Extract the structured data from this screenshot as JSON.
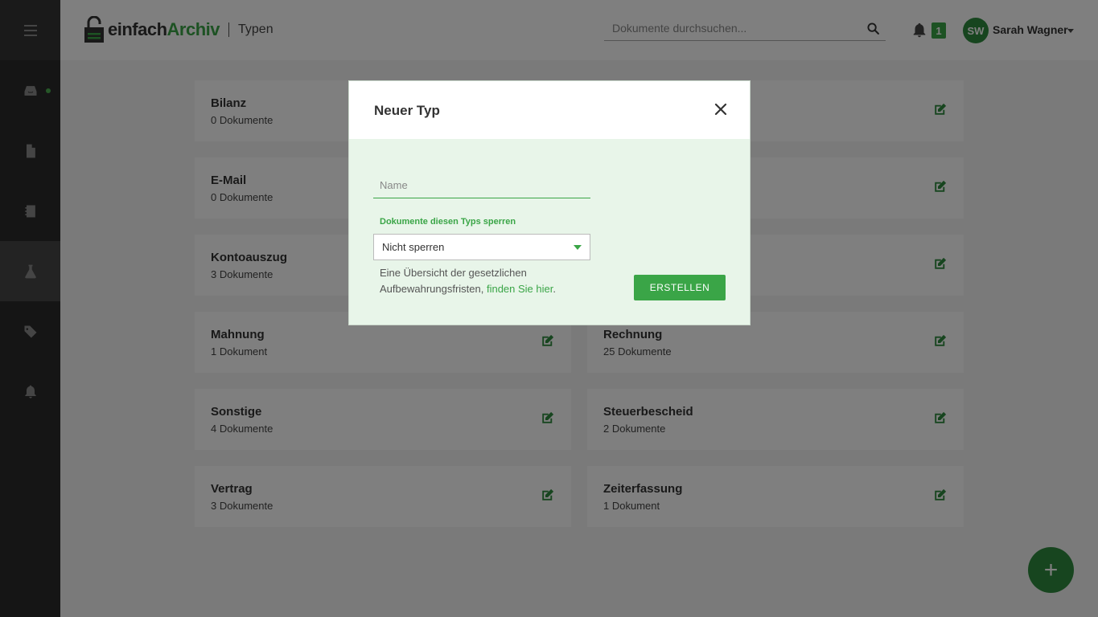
{
  "colors": {
    "brand_green": "#3aa547",
    "sidebar_bg": "#2b2b2b",
    "modal_bg": "#e8f5e9"
  },
  "sidebar": {
    "items": [
      {
        "name": "inbox-icon",
        "active": false,
        "has_dot": true
      },
      {
        "name": "document-icon",
        "active": false
      },
      {
        "name": "binder-icon",
        "active": false
      },
      {
        "name": "flask-icon",
        "active": true
      },
      {
        "name": "tag-icon",
        "active": false
      },
      {
        "name": "bell-icon",
        "active": false
      }
    ]
  },
  "header": {
    "logo_part1": "einfach",
    "logo_part2": "Archiv",
    "page_name": "Typen",
    "search_placeholder": "Dokumente durchsuchen...",
    "notification_count": "1",
    "user_initials": "SW",
    "user_name": "Sarah Wagner"
  },
  "cards": [
    {
      "title": "Bilanz",
      "count": "0 Dokumente"
    },
    {
      "title": "",
      "count": ""
    },
    {
      "title": "E-Mail",
      "count": "0 Dokumente"
    },
    {
      "title": "",
      "count": ""
    },
    {
      "title": "Kontoauszug",
      "count": "3 Dokumente"
    },
    {
      "title": "",
      "count": ""
    },
    {
      "title": "Mahnung",
      "count": "1 Dokument"
    },
    {
      "title": "Rechnung",
      "count": "25 Dokumente"
    },
    {
      "title": "Sonstige",
      "count": "4 Dokumente"
    },
    {
      "title": "Steuerbescheid",
      "count": "2 Dokumente"
    },
    {
      "title": "Vertrag",
      "count": "3 Dokumente"
    },
    {
      "title": "Zeiterfassung",
      "count": "1 Dokument"
    }
  ],
  "fab_label": "+",
  "modal": {
    "title": "Neuer Typ",
    "name_placeholder": "Name",
    "lock_label": "Dokumente diesen Typs sperren",
    "lock_selected": "Nicht sperren",
    "info_text": "Eine Übersicht der gesetzlichen Aufbewahrungsfristen, ",
    "info_link": "finden Sie hier",
    "info_end": ".",
    "create_label": "ERSTELLEN"
  }
}
